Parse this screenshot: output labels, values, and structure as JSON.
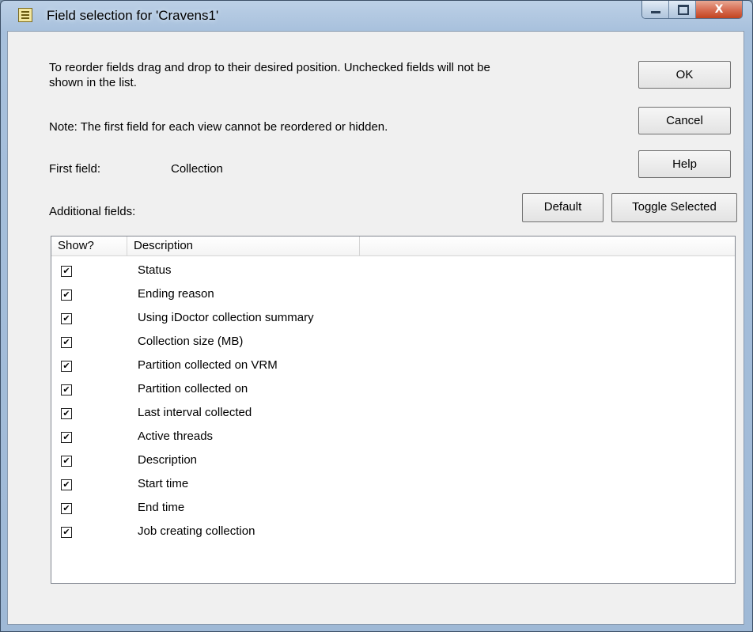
{
  "window": {
    "title": "Field selection for 'Cravens1'",
    "close_glyph": "X"
  },
  "instructions": "To reorder fields drag and drop to their desired position.  Unchecked fields will not be",
  "instructions_line2": "shown in the list.",
  "note": "Note:  The first field for each view cannot be reordered or hidden.",
  "first_field": {
    "label": "First field:",
    "value": "Collection"
  },
  "additional_label": "Additional fields:",
  "buttons": {
    "ok": "OK",
    "cancel": "Cancel",
    "help": "Help",
    "default": "Default",
    "toggle": "Toggle Selected"
  },
  "list": {
    "columns": [
      "Show?",
      "Description"
    ],
    "check_glyph": "✔",
    "rows": [
      {
        "label": "Status",
        "checked": true
      },
      {
        "label": "Ending reason",
        "checked": true
      },
      {
        "label": "Using iDoctor collection summary",
        "checked": true
      },
      {
        "label": "Collection size (MB)",
        "checked": true
      },
      {
        "label": "Partition collected on VRM",
        "checked": true
      },
      {
        "label": "Partition collected on",
        "checked": true
      },
      {
        "label": "Last interval collected",
        "checked": true
      },
      {
        "label": "Active threads",
        "checked": true
      },
      {
        "label": "Description",
        "checked": true
      },
      {
        "label": "Start time",
        "checked": true
      },
      {
        "label": "End time",
        "checked": true
      },
      {
        "label": "Job creating collection",
        "checked": true
      }
    ]
  }
}
